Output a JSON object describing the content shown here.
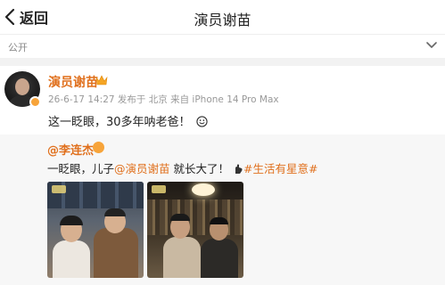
{
  "header": {
    "back_label": "返回",
    "title": "演员谢苗"
  },
  "visibility": {
    "label": "公开"
  },
  "post": {
    "author": "演员谢苗",
    "meta": "26-6-17 14:27  发布于 北京  来自 iPhone 14 Pro Max",
    "text": "这一眨眼，30多年呐老爸！"
  },
  "repost": {
    "author": "@李连杰",
    "text_prefix": "一眨眼，儿子",
    "mention": "@演员谢苗",
    "text_middle": " 就长大了！",
    "hashtag": "#生活有星意#"
  },
  "icons": {
    "back": "chevron-left-icon",
    "visibility": "chevron-down-icon",
    "vip": "crown-icon",
    "verified": "verified-badge-icon",
    "emoji_smile": "smile-emoji-icon",
    "emoji_hand": "hand-emoji-icon"
  },
  "colors": {
    "accent": "#e0701d",
    "badge": "#f7a43a"
  }
}
